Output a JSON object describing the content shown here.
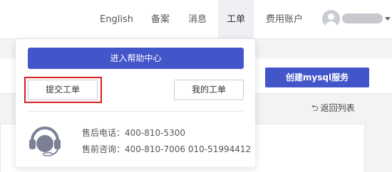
{
  "nav": {
    "english": "English",
    "beian": "备案",
    "messages": "消息",
    "ticket": "工单",
    "billing": "费用账户"
  },
  "dropdown": {
    "help_center": "进入帮助中心",
    "submit_ticket": "提交工单",
    "my_tickets": "我的工单",
    "after_sales": "售后电话：400-810-5300",
    "pre_sales": "售前咨询：400-810-7006 010-51994412"
  },
  "page": {
    "create_button": "创建mysql服务",
    "back_link": "返回列表"
  },
  "colors": {
    "primary": "#4356c9",
    "highlight": "#d81e1e"
  },
  "icons": {
    "user": "user-avatar-icon",
    "caret": "caret-down-icon",
    "back": "return-arrow-icon",
    "support": "headset-icon"
  }
}
